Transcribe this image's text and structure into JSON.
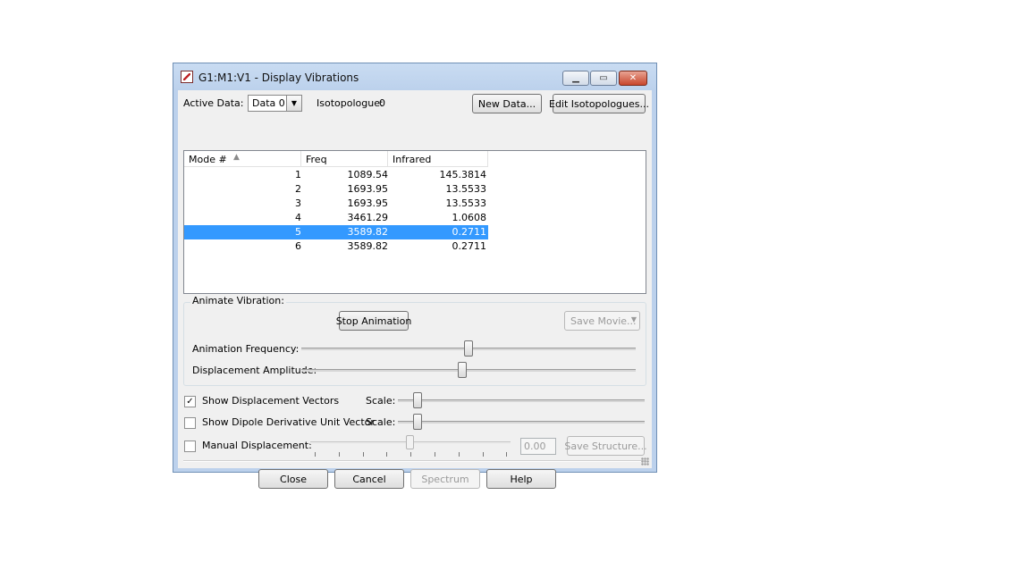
{
  "window": {
    "title": "G1:M1:V1 - Display Vibrations"
  },
  "toolbar": {
    "active_data_label": "Active Data:",
    "active_data_value": "Data 0",
    "isotopologue_label": "Isotopologue:",
    "isotopologue_value": "0",
    "new_data_button": "New Data...",
    "edit_isotopologues_button": "Edit Isotopologues..."
  },
  "table": {
    "columns": [
      "Mode #",
      "Freq",
      "Infrared"
    ],
    "rows": [
      {
        "mode": "1",
        "freq": "1089.54",
        "infrared": "145.3814"
      },
      {
        "mode": "2",
        "freq": "1693.95",
        "infrared": "13.5533"
      },
      {
        "mode": "3",
        "freq": "1693.95",
        "infrared": "13.5533"
      },
      {
        "mode": "4",
        "freq": "3461.29",
        "infrared": "1.0608"
      },
      {
        "mode": "5",
        "freq": "3589.82",
        "infrared": "0.2711"
      },
      {
        "mode": "6",
        "freq": "3589.82",
        "infrared": "0.2711"
      }
    ],
    "selected_row": "5"
  },
  "animate": {
    "group_label": "Animate Vibration:",
    "stop_button": "Stop Animation",
    "save_movie_button": "Save Movie...",
    "frequency_label": "Animation Frequency:",
    "frequency_level": 0.5,
    "amplitude_label": "Displacement Amplitude:",
    "amplitude_level": 0.48
  },
  "options": {
    "show_displacement_vectors": {
      "label": "Show Displacement Vectors",
      "checked": true,
      "scale_label": "Scale:",
      "scale_level": 0.08
    },
    "show_dipole_vector": {
      "label": "Show Dipole Derivative Unit Vector",
      "checked": false,
      "scale_label": "Scale:",
      "scale_level": 0.08
    },
    "manual_displacement": {
      "label": "Manual Displacement:",
      "checked": false,
      "value": "0.00",
      "level": 0.5,
      "save_structure_button": "Save Structure..."
    }
  },
  "footer": {
    "close_button": "Close",
    "cancel_button": "Cancel",
    "spectrum_button": "Spectrum",
    "help_button": "Help"
  },
  "colors": {
    "selection": "#3399ff",
    "titlebar": "#bcd1ec",
    "close_button": "#c9462c"
  }
}
